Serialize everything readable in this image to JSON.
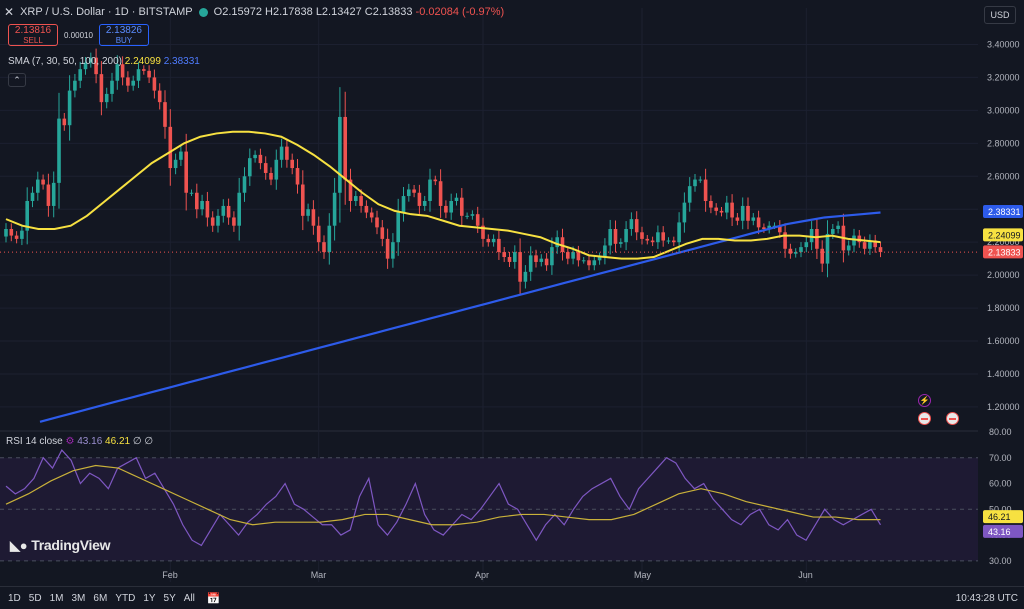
{
  "header": {
    "symbol": "XRP / U.S. Dollar · 1D · BITSTAMP",
    "open": "O2.15972",
    "high": "H2.17838",
    "low": "L2.13427",
    "close": "C2.13833",
    "change": "-0.02084 (-0.97%)"
  },
  "trade": {
    "sell_price": "2.13816",
    "sell_label": "SELL",
    "spread": "0.00010",
    "buy_price": "2.13826",
    "buy_label": "BUY"
  },
  "indicator": {
    "label": "SMA (7, 30, 50, 100, 200)",
    "value_sma50": "2.24099",
    "value_sma200": "2.38331"
  },
  "rsi_header": {
    "label": "RSI 14 close",
    "rsi": "43.16",
    "rsi_ma": "46.21",
    "extra": "∅ ∅"
  },
  "currency_button": "USD",
  "logo_text": "TradingView",
  "bottom": {
    "ranges": [
      "1D",
      "5D",
      "1M",
      "3M",
      "6M",
      "YTD",
      "1Y",
      "5Y",
      "All"
    ],
    "time": "10:43:28 UTC"
  },
  "colors": {
    "up": "#26a69a",
    "down": "#ef5350",
    "sma50": "#f7e141",
    "sma200": "#2d5bea",
    "rsi": "#7e57c2",
    "rsi_ma": "#c9b13a",
    "background": "#131722"
  },
  "chart_data": {
    "type": "candlestick",
    "price_axis": {
      "ticks": [
        1.2,
        1.4,
        1.6,
        1.8,
        2.0,
        2.2,
        2.4,
        2.6,
        2.8,
        3.0,
        3.2,
        3.4
      ],
      "tick_labels": [
        "1.20000",
        "1.40000",
        "1.60000",
        "1.80000",
        "2.00000",
        "2.20000",
        "2.40000",
        "2.60000",
        "2.80000",
        "3.00000",
        "3.20000",
        "3.40000"
      ],
      "range": [
        1.06,
        3.5
      ]
    },
    "time_axis": {
      "labels": [
        "Feb",
        "Mar",
        "Apr",
        "May",
        "Jun"
      ],
      "label_day_index": [
        31,
        59,
        90,
        120,
        151
      ]
    },
    "last_price_labels": {
      "sma200": "2.38331",
      "sma50": "2.24099",
      "price": "2.13833"
    },
    "closes": [
      2.28,
      2.24,
      2.22,
      2.27,
      2.45,
      2.5,
      2.58,
      2.55,
      2.42,
      2.56,
      2.95,
      2.91,
      3.12,
      3.18,
      3.25,
      3.29,
      3.32,
      3.22,
      3.05,
      3.1,
      3.18,
      3.28,
      3.2,
      3.15,
      3.18,
      3.25,
      3.24,
      3.2,
      3.12,
      3.05,
      2.9,
      2.65,
      2.7,
      2.75,
      2.5,
      2.5,
      2.4,
      2.45,
      2.35,
      2.3,
      2.36,
      2.42,
      2.35,
      2.3,
      2.5,
      2.6,
      2.71,
      2.73,
      2.68,
      2.62,
      2.58,
      2.7,
      2.78,
      2.7,
      2.65,
      2.55,
      2.36,
      2.4,
      2.3,
      2.2,
      2.14,
      2.3,
      2.5,
      2.96,
      2.58,
      2.45,
      2.48,
      2.42,
      2.38,
      2.35,
      2.29,
      2.22,
      2.1,
      2.2,
      2.38,
      2.48,
      2.52,
      2.5,
      2.42,
      2.45,
      2.58,
      2.57,
      2.42,
      2.38,
      2.45,
      2.47,
      2.36,
      2.36,
      2.37,
      2.3,
      2.22,
      2.2,
      2.22,
      2.14,
      2.11,
      2.08,
      2.14,
      1.96,
      2.02,
      2.12,
      2.08,
      2.1,
      2.06,
      2.17,
      2.23,
      2.14,
      2.1,
      2.14,
      2.09,
      2.09,
      2.06,
      2.09,
      2.11,
      2.18,
      2.28,
      2.19,
      2.2,
      2.28,
      2.34,
      2.26,
      2.22,
      2.21,
      2.2,
      2.26,
      2.21,
      2.21,
      2.2,
      2.32,
      2.44,
      2.54,
      2.58,
      2.58,
      2.45,
      2.41,
      2.39,
      2.38,
      2.44,
      2.35,
      2.33,
      2.42,
      2.33,
      2.35,
      2.29,
      2.28,
      2.3,
      2.3,
      2.26,
      2.16,
      2.13,
      2.14,
      2.17,
      2.2,
      2.28,
      2.16,
      2.07,
      2.25,
      2.28,
      2.3,
      2.15,
      2.18,
      2.24,
      2.2,
      2.16,
      2.21,
      2.17,
      2.14
    ],
    "sma50": [
      2.34,
      2.3,
      2.28,
      2.28,
      2.3,
      2.36,
      2.44,
      2.52,
      2.6,
      2.68,
      2.74,
      2.8,
      2.84,
      2.86,
      2.87,
      2.87,
      2.86,
      2.84,
      2.79,
      2.73,
      2.66,
      2.58,
      2.5,
      2.43,
      2.39,
      2.37,
      2.36,
      2.33,
      2.3,
      2.29,
      2.28,
      2.27,
      2.25,
      2.23,
      2.19,
      2.16,
      2.12,
      2.11,
      2.1,
      2.1,
      2.11,
      2.15,
      2.19,
      2.22,
      2.22,
      2.21,
      2.21,
      2.22,
      2.24,
      2.24,
      2.23,
      2.24,
      2.22,
      2.21,
      2.2
    ],
    "sma200": [
      1.11,
      1.14,
      1.17,
      1.2,
      1.23,
      1.26,
      1.29,
      1.32,
      1.35,
      1.38,
      1.41,
      1.44,
      1.47,
      1.5,
      1.53,
      1.56,
      1.59,
      1.62,
      1.65,
      1.68,
      1.71,
      1.74,
      1.77,
      1.8,
      1.83,
      1.86,
      1.89,
      1.92,
      1.95,
      1.98,
      2.01,
      2.04,
      2.07,
      2.1,
      2.13,
      2.16,
      2.19,
      2.22,
      2.25,
      2.28,
      2.31,
      2.33,
      2.35,
      2.36,
      2.37,
      2.38
    ],
    "rsi_axis": {
      "ticks": [
        30,
        40,
        50,
        60,
        70,
        80
      ],
      "tick_labels": [
        "30.00",
        "40.00",
        "50.00",
        "60.00",
        "70.00",
        "80.00"
      ],
      "range": [
        28,
        80
      ],
      "band": [
        30,
        70
      ]
    },
    "rsi": [
      59,
      56,
      58,
      62,
      70,
      66,
      73,
      69,
      60,
      64,
      62,
      58,
      66,
      68,
      70,
      62,
      64,
      58,
      52,
      44,
      38,
      36,
      42,
      48,
      44,
      40,
      45,
      48,
      52,
      55,
      60,
      52,
      50,
      47,
      44,
      44,
      40,
      42,
      55,
      62,
      44,
      40,
      45,
      52,
      60,
      48,
      42,
      40,
      44,
      48,
      46,
      50,
      55,
      60,
      52,
      50,
      44,
      38,
      44,
      48,
      44,
      50,
      55,
      58,
      60,
      62,
      55,
      50,
      58,
      62,
      66,
      70,
      68,
      62,
      58,
      60,
      54,
      50,
      46,
      44,
      48,
      50,
      44,
      42,
      46,
      40,
      38,
      44,
      50,
      46,
      44,
      46,
      48,
      50,
      44
    ],
    "rsi_ma": [
      52,
      56,
      61,
      65,
      67,
      66,
      62,
      58,
      54,
      50,
      46,
      44,
      45,
      45,
      45,
      46,
      48,
      48,
      46,
      44,
      44,
      45,
      47,
      48,
      48,
      47,
      46,
      46,
      48,
      52,
      56,
      58,
      56,
      53,
      51,
      49,
      47,
      47,
      46,
      46
    ],
    "rsi_last_labels": {
      "rsi_ma": "46.21",
      "rsi": "43.16"
    }
  }
}
